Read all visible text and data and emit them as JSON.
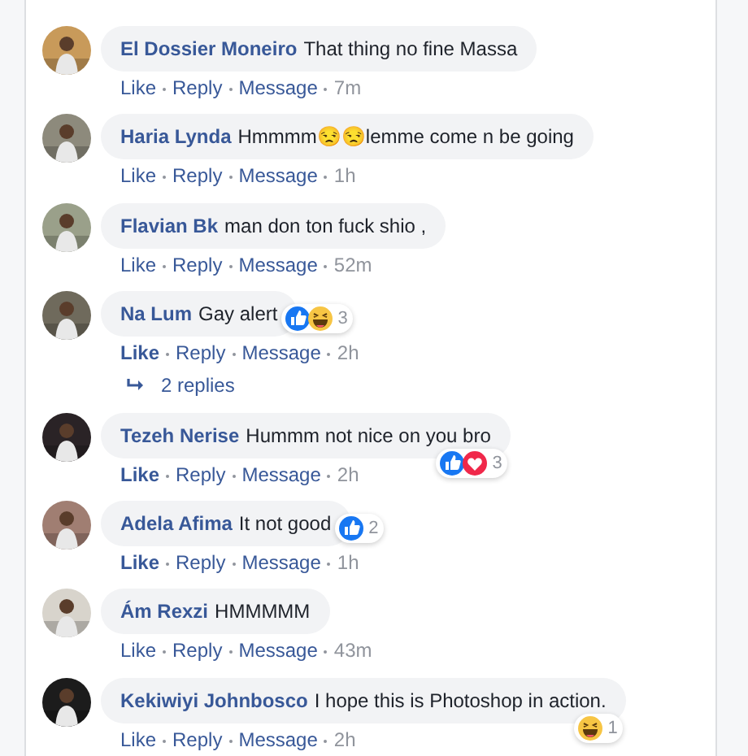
{
  "comments": [
    {
      "author": "El Dossier Moneiro",
      "text": "That thing no fine Massa",
      "actions": [
        {
          "label": "Like",
          "selected": false
        },
        {
          "label": "Reply",
          "selected": false
        },
        {
          "label": "Message",
          "selected": false
        }
      ],
      "time": "7m"
    },
    {
      "author": "Haria Lynda",
      "text": "Hmmmm😒😒lemme come n be going",
      "actions": [
        {
          "label": "Like",
          "selected": false
        },
        {
          "label": "Reply",
          "selected": false
        },
        {
          "label": "Message",
          "selected": false
        }
      ],
      "time": "1h"
    },
    {
      "author": "Flavian Bk",
      "text": "man don ton fuck shio ,",
      "actions": [
        {
          "label": "Like",
          "selected": false
        },
        {
          "label": "Reply",
          "selected": false
        },
        {
          "label": "Message",
          "selected": false
        }
      ],
      "time": "52m"
    },
    {
      "author": "Na Lum",
      "text": "Gay alert",
      "actions": [
        {
          "label": "Like",
          "selected": true
        },
        {
          "label": "Reply",
          "selected": false
        },
        {
          "label": "Message",
          "selected": false
        }
      ],
      "time": "2h",
      "reactions": {
        "icons": [
          {
            "kind": "like"
          },
          {
            "kind": "haha"
          }
        ],
        "count": "3"
      },
      "replies": "2 replies"
    },
    {
      "author": "Tezeh Nerise",
      "text": "Hummm not nice on you bro",
      "actions": [
        {
          "label": "Like",
          "selected": true
        },
        {
          "label": "Reply",
          "selected": false
        },
        {
          "label": "Message",
          "selected": false
        }
      ],
      "time": "2h",
      "reactions": {
        "icons": [
          {
            "kind": "like"
          },
          {
            "kind": "love"
          }
        ],
        "count": "3"
      }
    },
    {
      "author": "Adela Afima",
      "text": "It not good",
      "actions": [
        {
          "label": "Like",
          "selected": true
        },
        {
          "label": "Reply",
          "selected": false
        },
        {
          "label": "Message",
          "selected": false
        }
      ],
      "time": "1h",
      "reactions": {
        "icons": [
          {
            "kind": "like"
          }
        ],
        "count": "2"
      }
    },
    {
      "author": "Ám Rexzi",
      "text": "HMMMMM",
      "actions": [
        {
          "label": "Like",
          "selected": false
        },
        {
          "label": "Reply",
          "selected": false
        },
        {
          "label": "Message",
          "selected": false
        }
      ],
      "time": "43m"
    },
    {
      "author": "Kekiwiyi Johnbosco",
      "text": "I hope this is Photoshop in action.",
      "actions": [
        {
          "label": "Like",
          "selected": false
        },
        {
          "label": "Reply",
          "selected": false
        },
        {
          "label": "Message",
          "selected": false
        }
      ],
      "time": "2h",
      "reactions": {
        "icons": [
          {
            "kind": "haha"
          }
        ],
        "count": "1"
      }
    }
  ]
}
